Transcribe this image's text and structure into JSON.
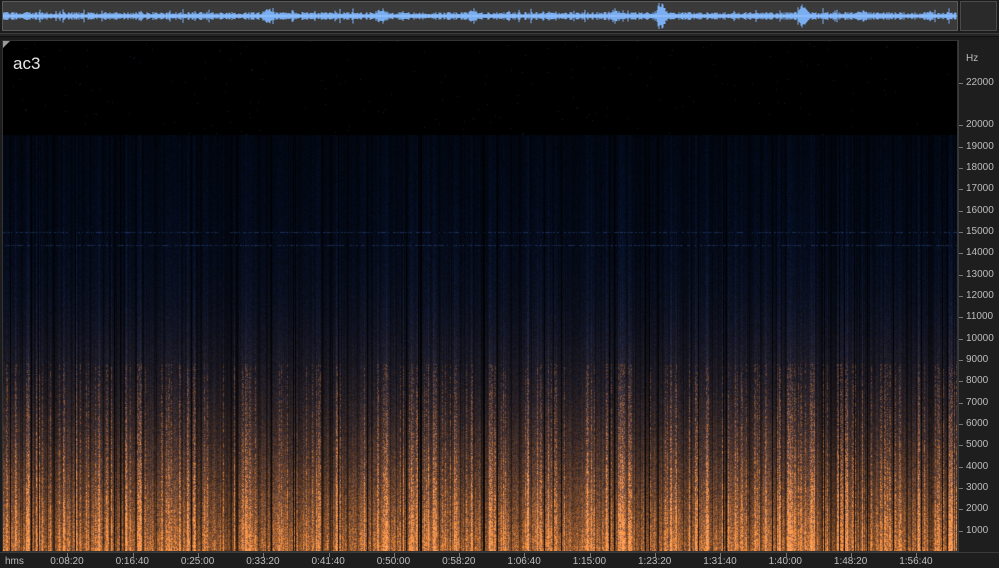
{
  "track": {
    "name": "ac3"
  },
  "freq_axis": {
    "unit": "Hz",
    "min_hz": 0,
    "max_hz": 24000,
    "labels": [
      "22000",
      "20000",
      "19000",
      "18000",
      "17000",
      "16000",
      "15000",
      "14000",
      "13000",
      "12000",
      "11000",
      "10000",
      "9000",
      "8000",
      "7000",
      "6000",
      "5000",
      "4000",
      "3000",
      "2000",
      "1000"
    ]
  },
  "time_axis": {
    "unit": "hms",
    "total_seconds": 7320,
    "labels": [
      "0:08:20",
      "0:16:40",
      "0:25:00",
      "0:33:20",
      "0:41:40",
      "0:50:00",
      "0:58:20",
      "1:06:40",
      "1:15:00",
      "1:23:20",
      "1:31:40",
      "1:40:00",
      "1:48:20",
      "1:56:40"
    ]
  },
  "colors": {
    "waveform": "#7aaef0",
    "spectrogram_low": "#1f4478",
    "spectrogram_high": "#ff8a26",
    "background": "#000000"
  },
  "audio": {
    "lowpass_cutoff_hz": 19600
  }
}
